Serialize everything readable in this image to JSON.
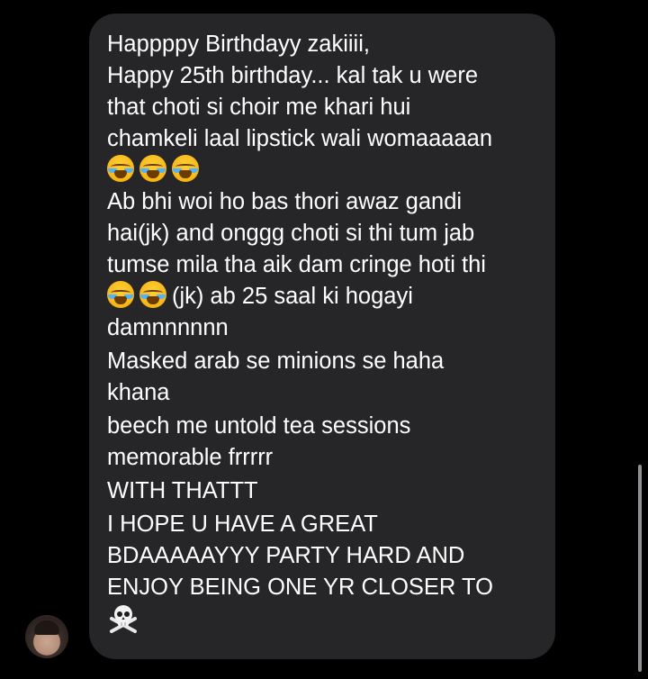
{
  "message": {
    "paragraphs": [
      {
        "lines": [
          "Happppy Birthdayy zakiiii,",
          "Happy 25th birthday... kal tak u were",
          "that choti si choir me khari hui",
          "chamkeli laal lipstick wali womaaaaan"
        ]
      },
      {
        "lines": [
          "Ab bhi woi ho bas thori awaz gandi",
          "hai(jk) and onggg choti si thi tum jab",
          "tumse mila tha aik dam cringe hoti thi"
        ]
      },
      {
        "lines": [
          "(jk) ab 25 saal ki hogayi",
          "damnnnnnn"
        ]
      },
      {
        "lines": [
          "Masked arab se minions se haha",
          "khana"
        ]
      },
      {
        "lines": [
          "beech me untold tea sessions",
          "memorable frrrrr"
        ]
      },
      {
        "lines": [
          "WITH THATTT"
        ]
      },
      {
        "lines": [
          "I HOPE U HAVE A GREAT",
          "BDAAAAAYYY PARTY HARD AND",
          "ENJOY BEING ONE YR CLOSER TO"
        ]
      }
    ],
    "emojis": {
      "after_intro": [
        "loudly-crying-face",
        "loudly-crying-face",
        "loudly-crying-face"
      ],
      "inline_jk": [
        "loudly-crying-face",
        "loudly-crying-face"
      ],
      "closing": "skull-and-crossbones"
    }
  },
  "colors": {
    "background": "#000000",
    "bubble": "#262628",
    "text": "#ffffff",
    "scrollbar": "#8e8e93"
  }
}
